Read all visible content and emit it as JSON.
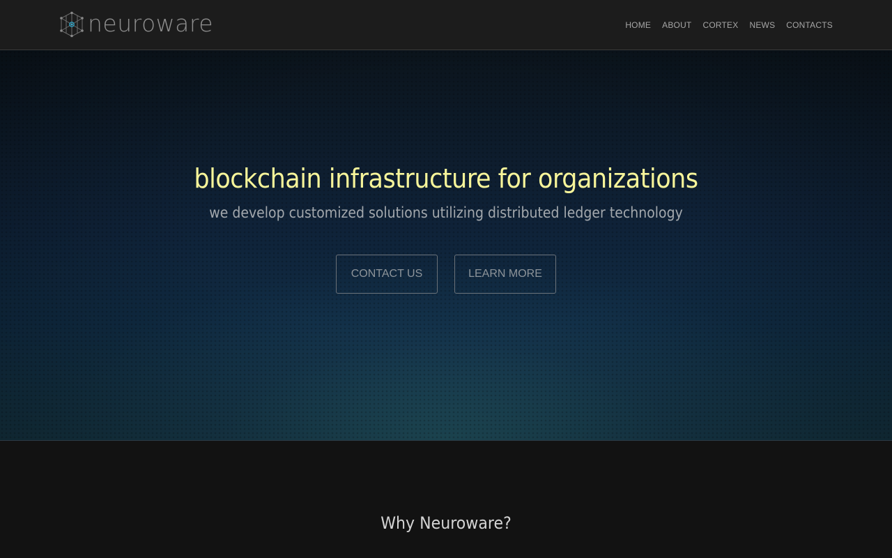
{
  "header": {
    "brand_name": "neuroware",
    "brand_icon": "cube-network-icon",
    "nav": [
      {
        "label": "HOME"
      },
      {
        "label": "ABOUT"
      },
      {
        "label": "CORTEX"
      },
      {
        "label": "NEWS"
      },
      {
        "label": "CONTACTS"
      }
    ]
  },
  "hero": {
    "title": "blockchain infrastructure for organizations",
    "subtitle": "we develop customized solutions utilizing distributed ledger technology",
    "buttons": {
      "contact_label": "CONTACT US",
      "learn_label": "LEARN MORE"
    }
  },
  "why": {
    "heading": "Why Neuroware?"
  },
  "colors": {
    "accent_yellow": "#f7f59a",
    "icon_blue": "#2ab0d8",
    "nav_text": "#a6a6a6"
  }
}
